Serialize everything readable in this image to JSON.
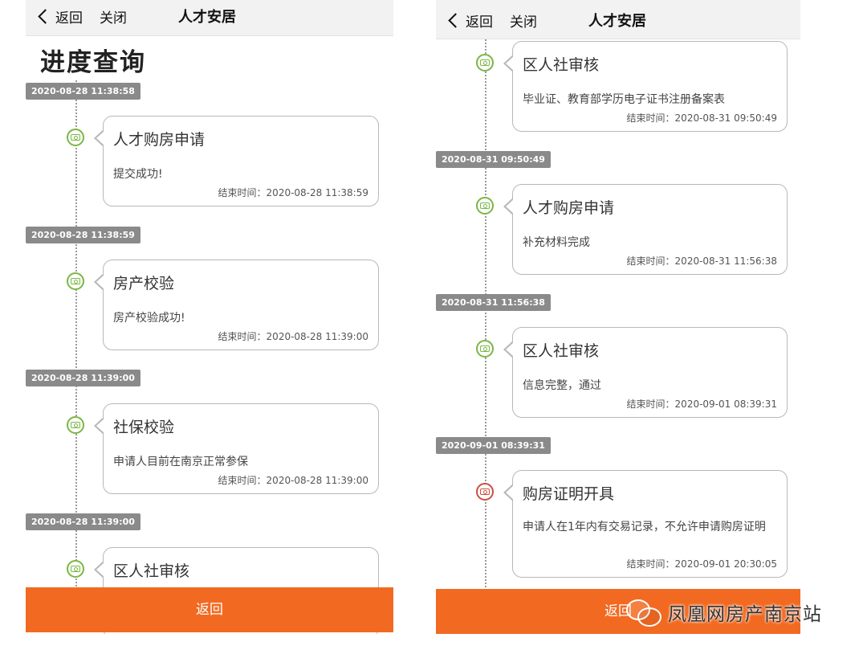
{
  "navbar": {
    "back_label": "返回",
    "close_label": "关闭",
    "title": "人才安居"
  },
  "left": {
    "page_title": "进度查询",
    "timestamps": [
      "2020-08-28 11:38:58",
      "2020-08-28 11:38:59",
      "2020-08-28 11:39:00",
      "2020-08-28 11:39:00"
    ],
    "cards": [
      {
        "title": "人才购房申请",
        "desc": "提交成功!",
        "end": "结束时间：2020-08-28 11:38:59"
      },
      {
        "title": "房产校验",
        "desc": "房产校验成功!",
        "end": "结束时间：2020-08-28 11:39:00"
      },
      {
        "title": "社保校验",
        "desc": "申请人目前在南京正常参保",
        "end": "结束时间：2020-08-28 11:39:00"
      },
      {
        "title": "区人社审核"
      }
    ],
    "bottom_button": "返回"
  },
  "right": {
    "timestamps": [
      "2020-08-31 09:50:49",
      "2020-08-31 11:56:38",
      "2020-09-01 08:39:31"
    ],
    "cards": [
      {
        "title": "区人社审核",
        "desc": "毕业证、教育部学历电子证书注册备案表",
        "end": "结束时间：2020-08-31 09:50:49"
      },
      {
        "title": "人才购房申请",
        "desc": "补充材料完成",
        "end": "结束时间：2020-08-31 11:56:38"
      },
      {
        "title": "区人社审核",
        "desc": "信息完整，通过",
        "end": "结束时间：2020-09-01 08:39:31"
      },
      {
        "title": "购房证明开具",
        "desc": "申请人在1年内有交易记录，不允许申请购房证明",
        "end": "结束时间：2020-09-01 20:30:05",
        "status": "rejected"
      }
    ],
    "bottom_button": "返回"
  },
  "watermark": {
    "text": "凤凰网房产南京站",
    "logo_icon": "wechat-icon"
  },
  "colors": {
    "accent": "#f26a21",
    "node_ok": "#79b743",
    "node_rejected": "#c9513f",
    "badge": "#8a8a8a"
  }
}
